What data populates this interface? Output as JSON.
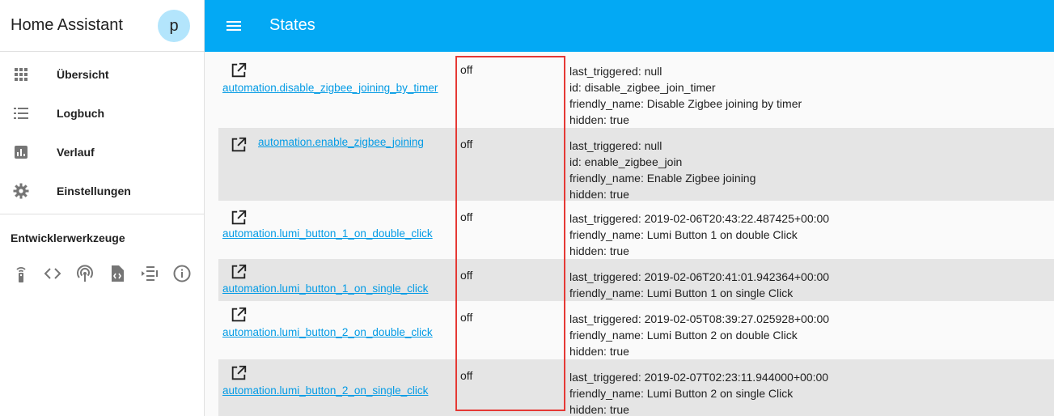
{
  "sidebar": {
    "app_title": "Home Assistant",
    "avatar_initial": "p",
    "items": [
      {
        "label": "Übersicht",
        "icon": "grid-icon"
      },
      {
        "label": "Logbuch",
        "icon": "list-icon"
      },
      {
        "label": "Verlauf",
        "icon": "chart-icon"
      },
      {
        "label": "Einstellungen",
        "icon": "gear-icon"
      }
    ],
    "dev_title": "Entwicklerwerkzeuge",
    "dev_tools": [
      "remote-icon",
      "code-icon",
      "broadcast-icon",
      "file-code-icon",
      "template-icon",
      "info-icon"
    ]
  },
  "header": {
    "title": "States",
    "menu_icon": "menu-icon"
  },
  "colors": {
    "header": "#03a9f4",
    "link": "#039be5",
    "highlight": "#e53935",
    "row_alt": "#e5e5e5"
  },
  "rows": [
    {
      "entity": "automation.disable_zigbee_joining_by_timer",
      "state": "off",
      "attributes": [
        "last_triggered: null",
        "id: disable_zigbee_join_timer",
        "friendly_name: Disable Zigbee joining by timer",
        "hidden: true"
      ]
    },
    {
      "entity": "automation.enable_zigbee_joining",
      "state": "off",
      "attributes": [
        "last_triggered: null",
        "id: enable_zigbee_join",
        "friendly_name: Enable Zigbee joining",
        "hidden: true"
      ]
    },
    {
      "entity": "automation.lumi_button_1_on_double_click",
      "state": "off",
      "attributes": [
        "last_triggered: 2019-02-06T20:43:22.487425+00:00",
        "friendly_name: Lumi Button 1 on double Click",
        "hidden: true"
      ]
    },
    {
      "entity": "automation.lumi_button_1_on_single_click",
      "state": "off",
      "attributes": [
        "last_triggered: 2019-02-06T20:41:01.942364+00:00",
        "friendly_name: Lumi Button 1 on single Click"
      ]
    },
    {
      "entity": "automation.lumi_button_2_on_double_click",
      "state": "off",
      "attributes": [
        "last_triggered: 2019-02-05T08:39:27.025928+00:00",
        "friendly_name: Lumi Button 2 on double Click",
        "hidden: true"
      ]
    },
    {
      "entity": "automation.lumi_button_2_on_single_click",
      "state": "off",
      "attributes": [
        "last_triggered: 2019-02-07T02:23:11.944000+00:00",
        "friendly_name: Lumi Button 2 on single Click",
        "hidden: true"
      ]
    }
  ]
}
